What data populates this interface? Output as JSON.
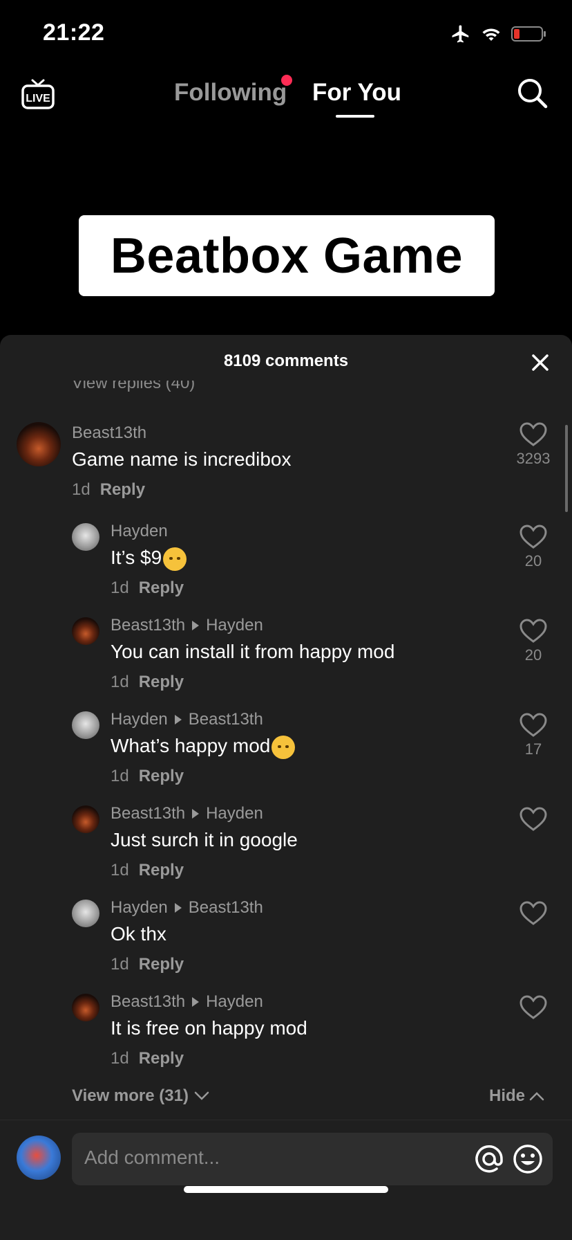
{
  "status": {
    "time": "21:22"
  },
  "nav": {
    "live_label": "LIVE",
    "following": "Following",
    "for_you": "For You"
  },
  "video": {
    "title": "Beatbox Game"
  },
  "comments_panel": {
    "count_label": "8109 comments",
    "view_replies_partial": "View replies (40)",
    "main_comment": {
      "user": "Beast13th",
      "text": "Game name is incredibox",
      "age": "1d",
      "reply": "Reply",
      "likes": "3293"
    },
    "replies": [
      {
        "user": "Hayden",
        "to": "",
        "text": "It’s $9",
        "emoji": "pensive-face",
        "age": "1d",
        "reply": "Reply",
        "likes": "20"
      },
      {
        "user": "Beast13th",
        "to": "Hayden",
        "text": "You can install it from happy mod",
        "emoji": "",
        "age": "1d",
        "reply": "Reply",
        "likes": "20"
      },
      {
        "user": "Hayden",
        "to": "Beast13th",
        "text": "What’s happy mod",
        "emoji": "raised-eyebrow-face",
        "age": "1d",
        "reply": "Reply",
        "likes": "17"
      },
      {
        "user": "Beast13th",
        "to": "Hayden",
        "text": "Just surch it in google",
        "emoji": "",
        "age": "1d",
        "reply": "Reply",
        "likes": ""
      },
      {
        "user": "Hayden",
        "to": "Beast13th",
        "text": "Ok thx",
        "emoji": "",
        "age": "1d",
        "reply": "Reply",
        "likes": ""
      },
      {
        "user": "Beast13th",
        "to": "Hayden",
        "text": "It is free on happy mod",
        "emoji": "",
        "age": "1d",
        "reply": "Reply",
        "likes": ""
      }
    ],
    "view_more": "View more (31)",
    "hide": "Hide"
  },
  "composer": {
    "placeholder": "Add comment..."
  },
  "colors": {
    "sheet_bg": "#1f1f1f",
    "accent": "#fe2c55"
  }
}
